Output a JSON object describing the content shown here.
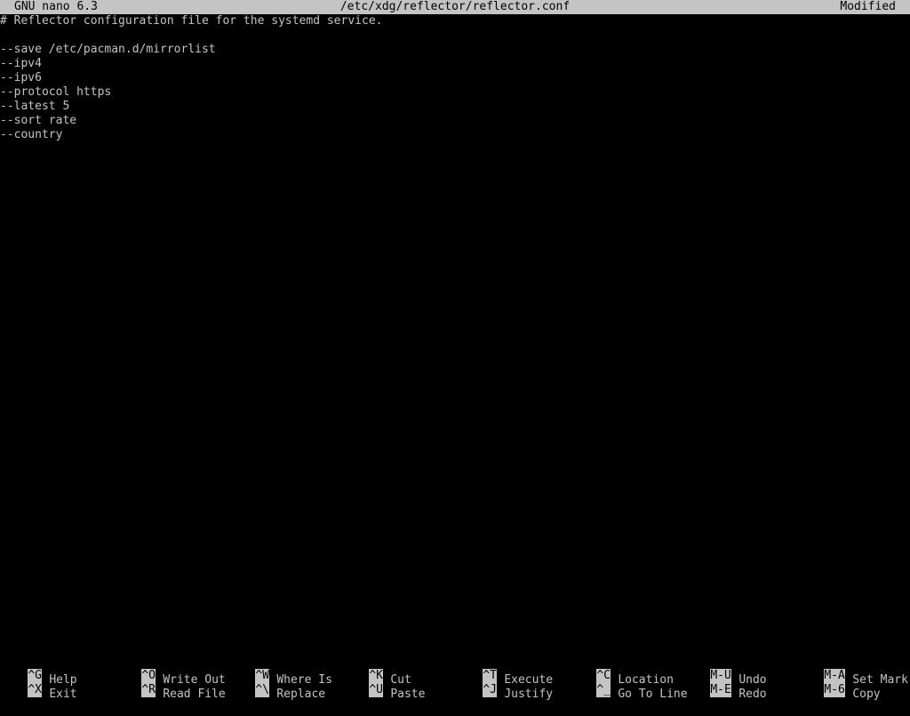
{
  "titlebar": {
    "version": "GNU nano 6.3",
    "filename": "/etc/xdg/reflector/reflector.conf",
    "state": "Modified"
  },
  "editor": {
    "lines": [
      "# Reflector configuration file for the systemd service.",
      "",
      "--save /etc/pacman.d/mirrorlist",
      "--ipv4",
      "--ipv6",
      "--protocol https",
      "--latest 5",
      "--sort rate",
      "--country"
    ]
  },
  "shortcuts": {
    "top": [
      {
        "key": "^G",
        "label": "Help"
      },
      {
        "key": "^O",
        "label": "Write Out"
      },
      {
        "key": "^W",
        "label": "Where Is"
      },
      {
        "key": "^K",
        "label": "Cut"
      },
      {
        "key": "^T",
        "label": "Execute"
      },
      {
        "key": "^C",
        "label": "Location"
      },
      {
        "key": "M-U",
        "label": "Undo"
      },
      {
        "key": "M-A",
        "label": "Set Mark"
      }
    ],
    "bottom": [
      {
        "key": "^X",
        "label": "Exit"
      },
      {
        "key": "^R",
        "label": "Read File"
      },
      {
        "key": "^\\",
        "label": "Replace"
      },
      {
        "key": "^U",
        "label": "Paste"
      },
      {
        "key": "^J",
        "label": "Justify"
      },
      {
        "key": "^_",
        "label": "Go To Line"
      },
      {
        "key": "M-E",
        "label": "Redo"
      },
      {
        "key": "M-6",
        "label": "Copy"
      }
    ]
  },
  "colors": {
    "background": "#000000",
    "foreground": "#c4c4c4",
    "inverse_bg": "#c4c4c4",
    "inverse_fg": "#000000"
  }
}
